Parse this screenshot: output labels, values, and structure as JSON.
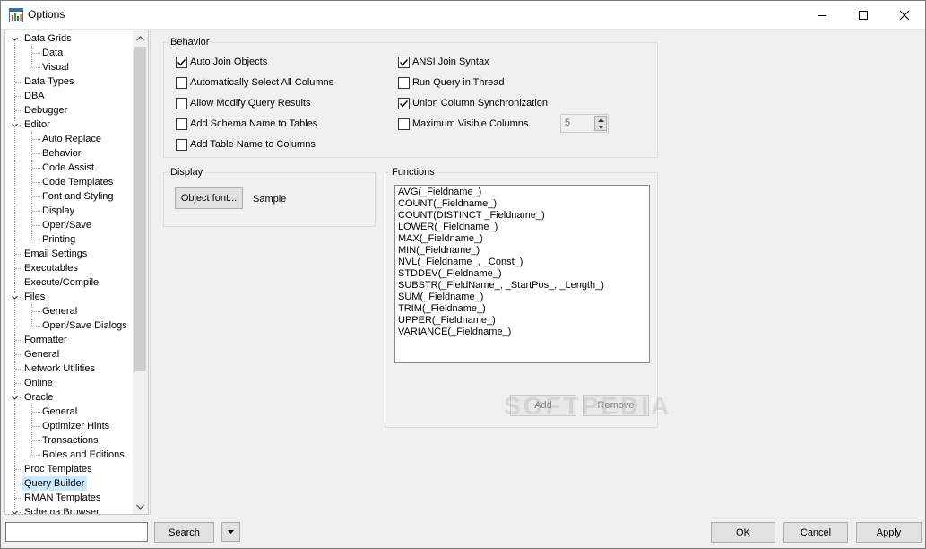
{
  "window": {
    "title": "Options"
  },
  "tree": {
    "items": [
      {
        "label": "Data Grids",
        "level": 0,
        "expanded": true
      },
      {
        "label": "Data",
        "level": 1
      },
      {
        "label": "Visual",
        "level": 1
      },
      {
        "label": "Data Types",
        "level": 0
      },
      {
        "label": "DBA",
        "level": 0
      },
      {
        "label": "Debugger",
        "level": 0
      },
      {
        "label": "Editor",
        "level": 0,
        "expanded": true
      },
      {
        "label": "Auto Replace",
        "level": 1
      },
      {
        "label": "Behavior",
        "level": 1
      },
      {
        "label": "Code Assist",
        "level": 1
      },
      {
        "label": "Code Templates",
        "level": 1
      },
      {
        "label": "Font and Styling",
        "level": 1
      },
      {
        "label": "Display",
        "level": 1
      },
      {
        "label": "Open/Save",
        "level": 1
      },
      {
        "label": "Printing",
        "level": 1
      },
      {
        "label": "Email Settings",
        "level": 0
      },
      {
        "label": "Executables",
        "level": 0
      },
      {
        "label": "Execute/Compile",
        "level": 0
      },
      {
        "label": "Files",
        "level": 0,
        "expanded": true
      },
      {
        "label": "General",
        "level": 1
      },
      {
        "label": "Open/Save Dialogs",
        "level": 1
      },
      {
        "label": "Formatter",
        "level": 0
      },
      {
        "label": "General",
        "level": 0
      },
      {
        "label": "Network Utilities",
        "level": 0
      },
      {
        "label": "Online",
        "level": 0
      },
      {
        "label": "Oracle",
        "level": 0,
        "expanded": true
      },
      {
        "label": "General",
        "level": 1
      },
      {
        "label": "Optimizer Hints",
        "level": 1
      },
      {
        "label": "Transactions",
        "level": 1
      },
      {
        "label": "Roles and Editions",
        "level": 1
      },
      {
        "label": "Proc Templates",
        "level": 0
      },
      {
        "label": "Query Builder",
        "level": 0,
        "selected": true
      },
      {
        "label": "RMAN Templates",
        "level": 0
      },
      {
        "label": "Schema Browser",
        "level": 0,
        "expanded": true
      }
    ]
  },
  "behavior": {
    "legend": "Behavior",
    "left_options": [
      {
        "label": "Auto Join Objects",
        "checked": true
      },
      {
        "label": "Automatically Select All Columns",
        "checked": false
      },
      {
        "label": "Allow Modify Query Results",
        "checked": false
      },
      {
        "label": "Add Schema Name to Tables",
        "checked": false
      },
      {
        "label": "Add Table Name to Columns",
        "checked": false
      }
    ],
    "right_options": [
      {
        "label": "ANSI Join Syntax",
        "checked": true
      },
      {
        "label": "Run Query in Thread",
        "checked": false
      },
      {
        "label": "Union Column Synchronization",
        "checked": true
      },
      {
        "label": "Maximum Visible Columns",
        "checked": false
      }
    ],
    "max_visible_columns_value": "5"
  },
  "display": {
    "legend": "Display",
    "object_font_button": "Object font...",
    "sample_text": "Sample"
  },
  "functions": {
    "legend": "Functions",
    "items": [
      "AVG(_Fieldname_)",
      "COUNT(_Fieldname_)",
      "COUNT(DISTINCT _Fieldname_)",
      "LOWER(_Fieldname_)",
      "MAX(_Fieldname_)",
      "MIN(_Fieldname_)",
      "NVL(_Fieldname_, _Const_)",
      "STDDEV(_Fieldname_)",
      "SUBSTR(_FieldName_, _StartPos_, _Length_)",
      "SUM(_Fieldname_)",
      "TRIM(_Fieldname_)",
      "UPPER(_Fieldname_)",
      "VARIANCE(_Fieldname_)"
    ],
    "add_button": "Add",
    "remove_button": "Remove"
  },
  "watermark": "SOFTPEDIA",
  "bottom": {
    "search_value": "",
    "search_button": "Search",
    "ok_button": "OK",
    "cancel_button": "Cancel",
    "apply_button": "Apply"
  }
}
